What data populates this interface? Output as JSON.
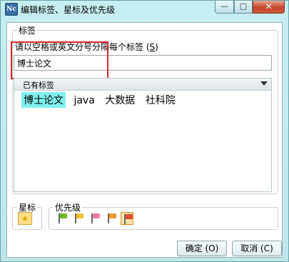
{
  "window": {
    "title": "编辑标签、星标及优先级",
    "app_icon_text": "Nc",
    "controls": {
      "minimize": "—",
      "maximize": "□",
      "close": "✕"
    }
  },
  "tags_group": {
    "legend": "标签",
    "instruction": "请以空格或英文分号分隔每个标签",
    "instruction_shortcut": "S",
    "input_value": "博士论文",
    "existing_label": "已有标签",
    "existing_tags": [
      {
        "text": "博士论文",
        "selected": true
      },
      {
        "text": "java",
        "selected": false
      },
      {
        "text": "大数据",
        "selected": false
      },
      {
        "text": "社科院",
        "selected": false
      }
    ]
  },
  "star_group": {
    "legend": "星标",
    "icon": "star-icon"
  },
  "priority_group": {
    "legend": "优先级",
    "flags": [
      {
        "name": "green-flag-icon",
        "color": "#74b82a"
      },
      {
        "name": "yellow-flag-icon",
        "color": "#f0c52c"
      },
      {
        "name": "pink-flag-icon",
        "color": "#f07aa2"
      },
      {
        "name": "orange-flag-icon",
        "color": "#f39a2e"
      },
      {
        "name": "red-flag-icon",
        "color": "#e84b2e",
        "selected": true
      }
    ]
  },
  "buttons": {
    "ok": "确定 (O)",
    "cancel": "取消 (C)"
  },
  "colors": {
    "accent_highlight": "#e0262a",
    "tag_selected_bg": "#7ff0f0"
  }
}
